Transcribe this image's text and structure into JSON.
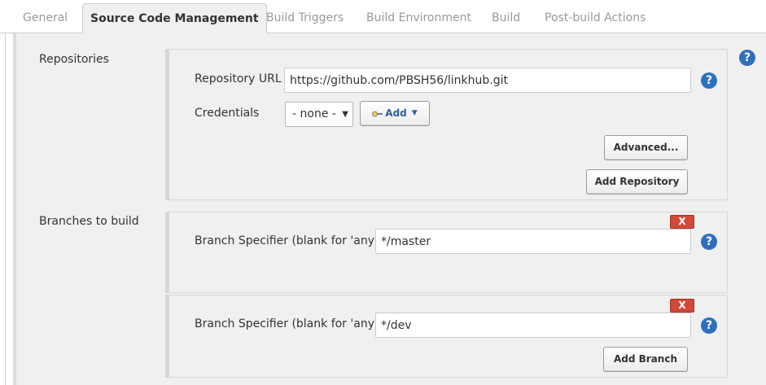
{
  "tabs": [
    {
      "label": "General"
    },
    {
      "label": "Source Code Management"
    },
    {
      "label": "Build Triggers"
    },
    {
      "label": "Build Environment"
    },
    {
      "label": "Build"
    },
    {
      "label": "Post-build Actions"
    }
  ],
  "active_tab": "Source Code Management",
  "repositories": {
    "section_label": "Repositories",
    "url_label": "Repository URL",
    "url_value": "https://github.com/PBSH56/linkhub.git",
    "credentials_label": "Credentials",
    "credentials_selected": "- none -",
    "add_label": "Add",
    "advanced_label": "Advanced...",
    "add_repository_label": "Add Repository"
  },
  "branches": {
    "section_label": "Branches to build",
    "items": [
      {
        "label": "Branch Specifier (blank for 'any')",
        "value": "*/master",
        "delete_label": "X"
      },
      {
        "label": "Branch Specifier (blank for 'any')",
        "value": "*/dev",
        "delete_label": "X"
      }
    ],
    "add_branch_label": "Add Branch"
  },
  "help_icon_text": "?",
  "colors": {
    "help_icon": "#2f6fc1",
    "delete_button": "#d24939",
    "panel_bg": "#f0f0f0"
  }
}
